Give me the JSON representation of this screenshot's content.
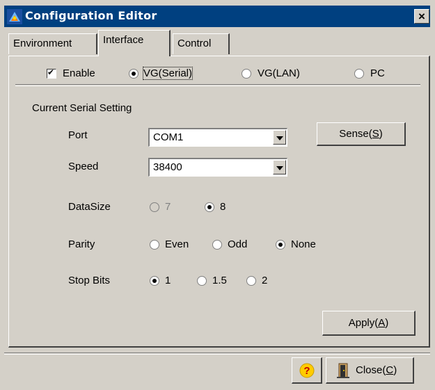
{
  "window": {
    "title": "Configuration Editor",
    "close_glyph": "×"
  },
  "tabs": [
    {
      "label": "Environment",
      "active": false
    },
    {
      "label": "Interface",
      "active": true
    },
    {
      "label": "Control",
      "active": false
    }
  ],
  "interface": {
    "enable_label": "Enable",
    "enable_checked": true,
    "modes": [
      "VG(Serial)",
      "VG(LAN)",
      "PC"
    ],
    "selected_mode": "VG(Serial)"
  },
  "serial": {
    "group_label": "Current Serial Setting",
    "port_label": "Port",
    "port_value": "COM1",
    "sense_label": "Sense(",
    "sense_key": "S",
    "speed_label": "Speed",
    "speed_value": "38400",
    "datasize_label": "DataSize",
    "datasize_options": [
      "7",
      "8"
    ],
    "datasize_selected": "8",
    "parity_label": "Parity",
    "parity_options": [
      "Even",
      "Odd",
      "None"
    ],
    "parity_selected": "None",
    "stopbits_label": "Stop Bits",
    "stopbits_options": [
      "1",
      "1.5",
      "2"
    ],
    "stopbits_selected": "1",
    "apply_label": "Apply(",
    "apply_key": "A"
  },
  "footer": {
    "help_glyph": "?",
    "close_label": "Close(",
    "close_key": "C"
  },
  "colors": {
    "titlebar": "#004080",
    "face": "#d4d0c8",
    "help_icon": "#ffcc00"
  },
  "icons": [
    "app-icon",
    "close-icon",
    "help-icon",
    "exit-door-icon",
    "chevron-down-icon"
  ]
}
